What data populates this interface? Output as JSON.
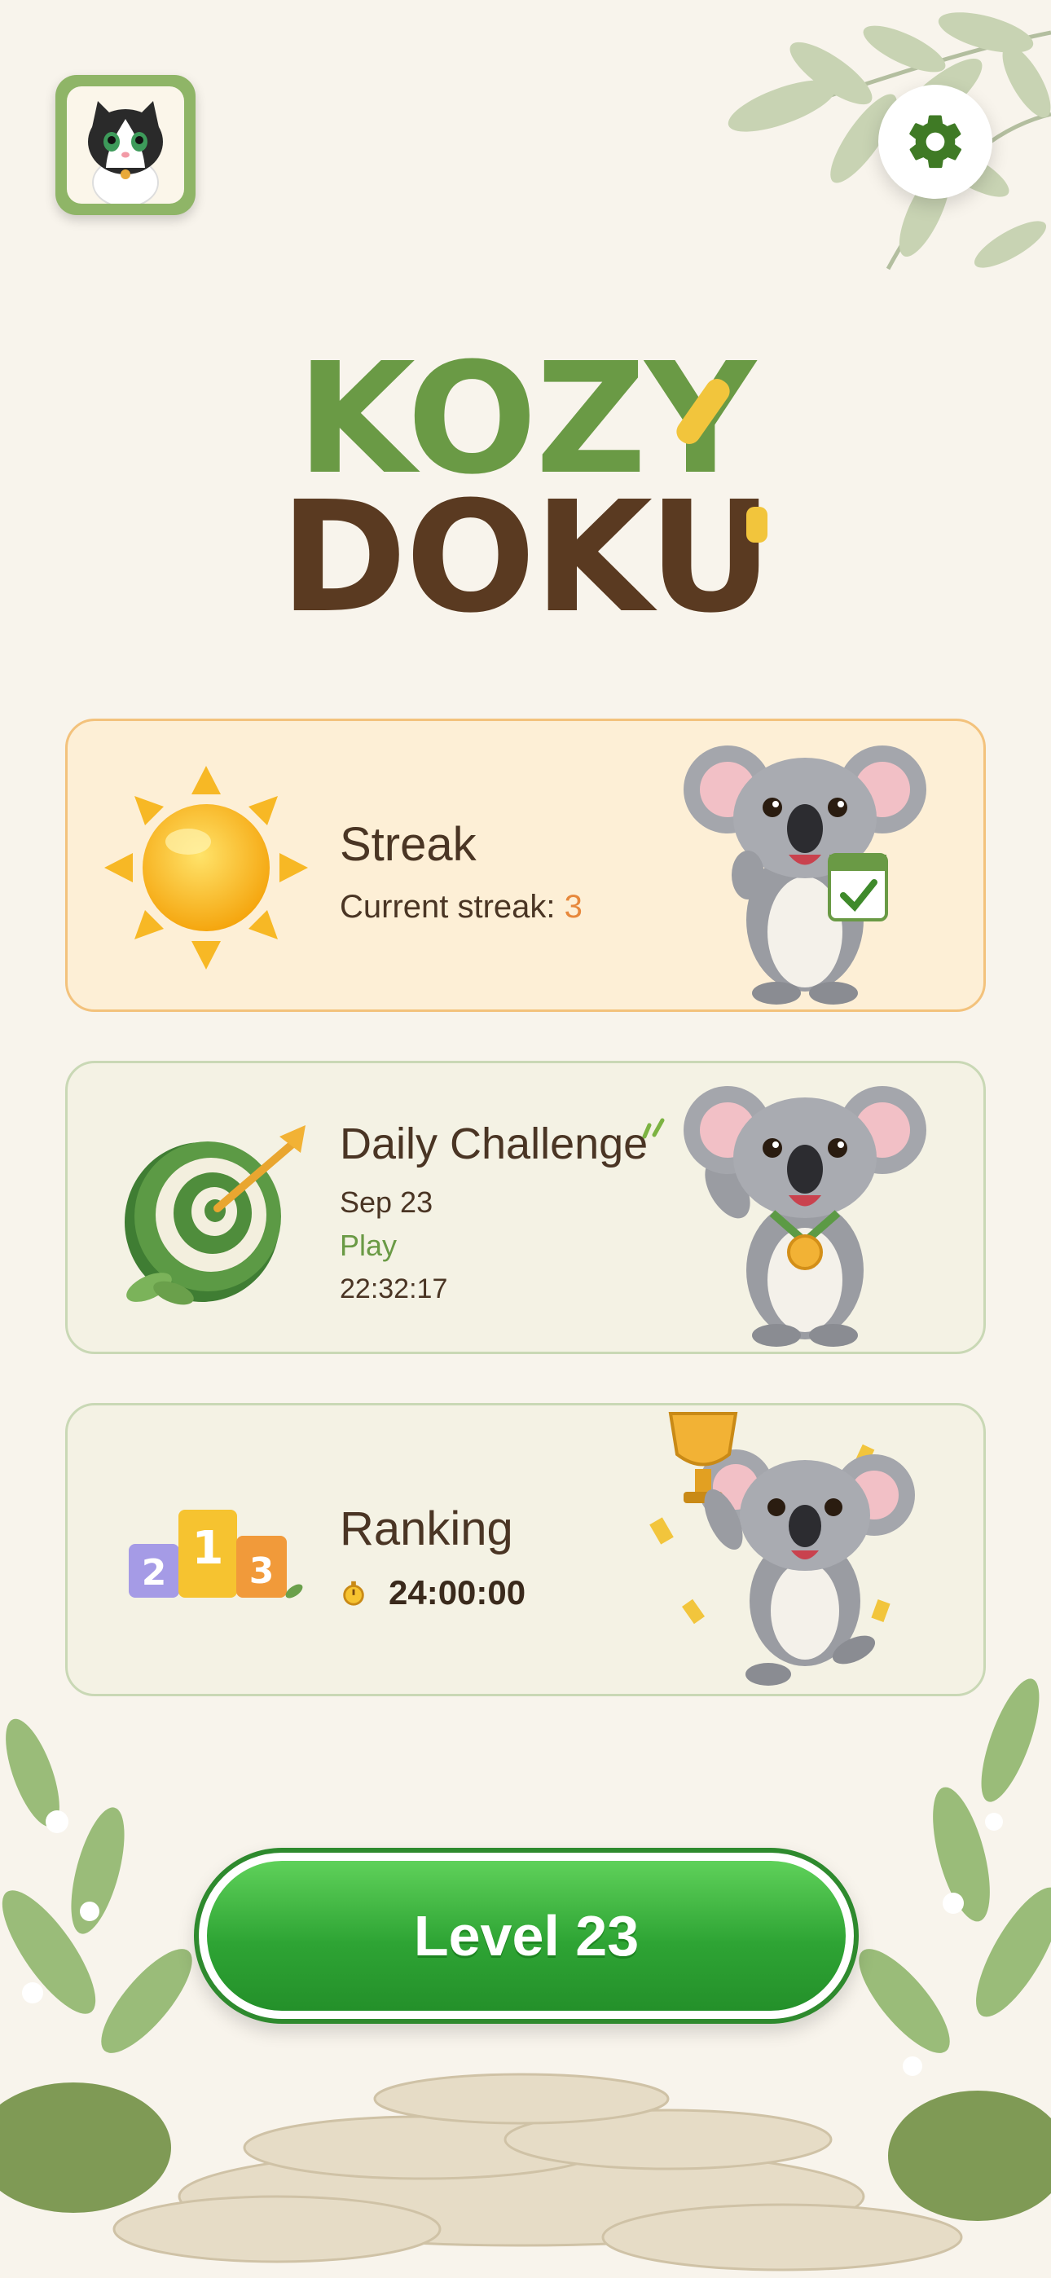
{
  "header": {
    "avatar": "cat-avatar-icon",
    "settings_icon": "gear-icon"
  },
  "logo": {
    "line1": "KOZY",
    "line2": "DOKU"
  },
  "cards": {
    "streak": {
      "title": "Streak",
      "subtitle_prefix": "Current streak: ",
      "streak_value": "3",
      "icon": "sun-icon",
      "mascot": "koala-calendar-icon"
    },
    "daily": {
      "title": "Daily Challenge",
      "date": "Sep 23",
      "action": "Play",
      "timer": "22:32:17",
      "icon": "target-icon",
      "mascot": "koala-medal-icon"
    },
    "ranking": {
      "title": "Ranking",
      "timer": "24:00:00",
      "icon": "podium-icon",
      "timer_icon": "stopwatch-icon",
      "mascot": "koala-trophy-icon",
      "podium_numbers": [
        "2",
        "1",
        "3"
      ]
    }
  },
  "play_button": {
    "label": "Level 23"
  },
  "colors": {
    "background": "#f8f4ec",
    "brand_green": "#6a9a45",
    "brand_brown": "#5a3a21",
    "accent_yellow": "#f2c53c",
    "button_green": "#2ea434",
    "streak_orange": "#e7883c"
  }
}
